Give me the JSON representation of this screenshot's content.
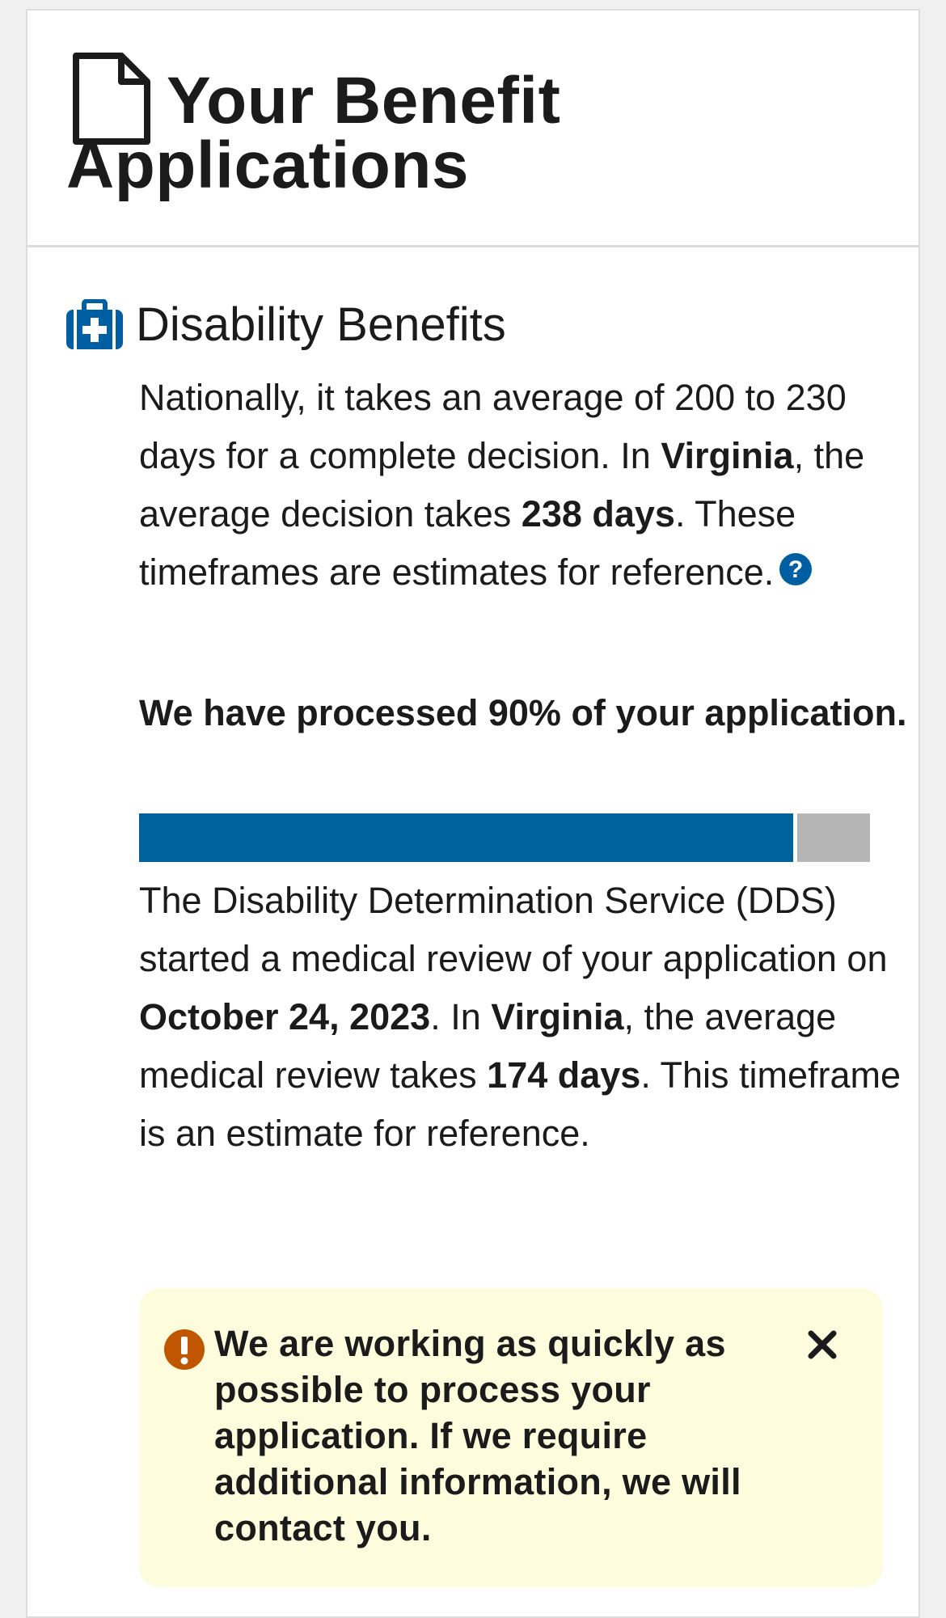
{
  "header": {
    "title": "Your Benefit Applications",
    "icon": "document-icon"
  },
  "benefit": {
    "icon": "medical-kit-icon",
    "title": "Disability Benefits",
    "national": {
      "part1": "Nationally, it takes an average of 200 to 230 days for a complete decision. In ",
      "state": "Virginia",
      "part2": ", the average decision takes ",
      "days": "238 days",
      "part3": ". These timeframes are estimates for reference."
    },
    "help_icon": "help-icon",
    "progress_text": "We have processed 90% of your application.",
    "progress_percent": 90,
    "dds": {
      "part1": "The Disability Determination Service (DDS) started a medical review of your application on ",
      "date": "October 24, 2023",
      "part2": ". In ",
      "state": "Virginia",
      "part3": ", the average medical review takes ",
      "days": "174 days",
      "part4": ". This timeframe is an estimate for reference."
    }
  },
  "alert": {
    "icon": "exclamation-icon",
    "text": "We are working as quickly as possible to process your application. If we require additional information, we will contact you.",
    "close_icon": "close-icon"
  },
  "colors": {
    "progress_fill": "#00629b",
    "progress_track": "#b5b5b5",
    "icon_blue": "#005ea2",
    "alert_bg": "#fdfcdc",
    "alert_icon": "#c05600"
  }
}
